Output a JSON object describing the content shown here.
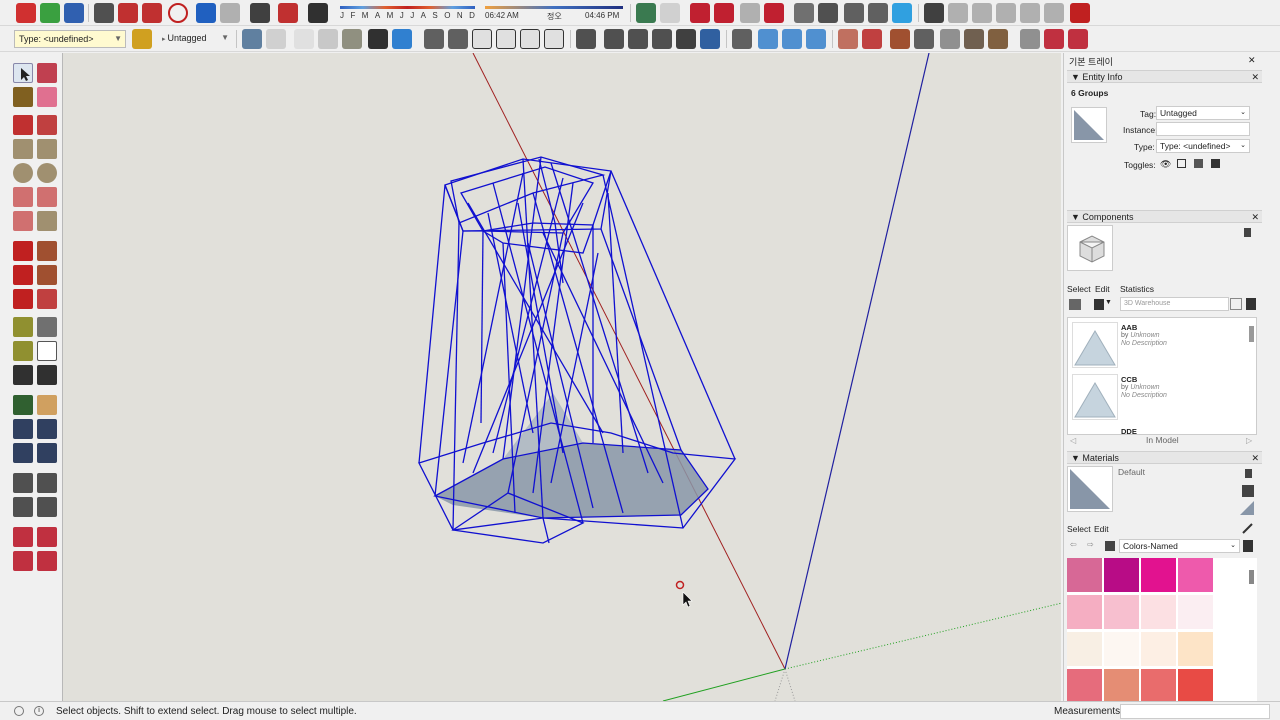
{
  "toolbar": {
    "type_field": "Type: <undefined>",
    "tag_field": "Untagged",
    "months": [
      "J",
      "F",
      "M",
      "A",
      "M",
      "J",
      "J",
      "A",
      "S",
      "O",
      "N",
      "D"
    ],
    "time_start": "06:42 AM",
    "time_noon": "정오",
    "time_end": "04:46 PM"
  },
  "tray": {
    "title": "기본 트레이",
    "entity_info": {
      "header": "Entity Info",
      "selection": "6 Groups",
      "tag_label": "Tag:",
      "tag_value": "Untagged",
      "instance_label": "Instance:",
      "instance_value": "",
      "type_label": "Type:",
      "type_value": "Type: <undefined>",
      "toggles_label": "Toggles:"
    },
    "components": {
      "header": "Components",
      "tabs": [
        "Select",
        "Edit",
        "Statistics"
      ],
      "search_placeholder": "3D Warehouse",
      "items": [
        {
          "name": "AAB",
          "by": "by",
          "author": "Unknown",
          "desc": "No Description"
        },
        {
          "name": "CCB",
          "by": "by",
          "author": "Unknown",
          "desc": "No Description"
        },
        {
          "name": "DDE",
          "by": "",
          "author": "",
          "desc": ""
        }
      ],
      "footer": "In Model"
    },
    "materials": {
      "header": "Materials",
      "current": "Default",
      "tabs": [
        "Select",
        "Edit"
      ],
      "library": "Colors-Named",
      "swatches": [
        "#d76896",
        "#b80c86",
        "#e2128f",
        "#ee5aac",
        "#f5aec2",
        "#f7bfcf",
        "#fce0e3",
        "#fbeef2",
        "#f8efe4",
        "#fdf7f2",
        "#fdefe4",
        "#fde4c7",
        "#e66c7c",
        "#e58d74",
        "#e96c6c",
        "#e84b45"
      ]
    }
  },
  "status": {
    "text": "Select objects. Shift to extend select. Drag mouse to select multiple.",
    "measurements_label": "Measurements",
    "measurements_value": ""
  },
  "colors": {
    "model_lines": "#1010d0",
    "selected_face": "#8896a8",
    "axis_red": "#a02020",
    "axis_blue": "#2020a0",
    "axis_green": "#20a020",
    "background": "#e1e0da"
  }
}
